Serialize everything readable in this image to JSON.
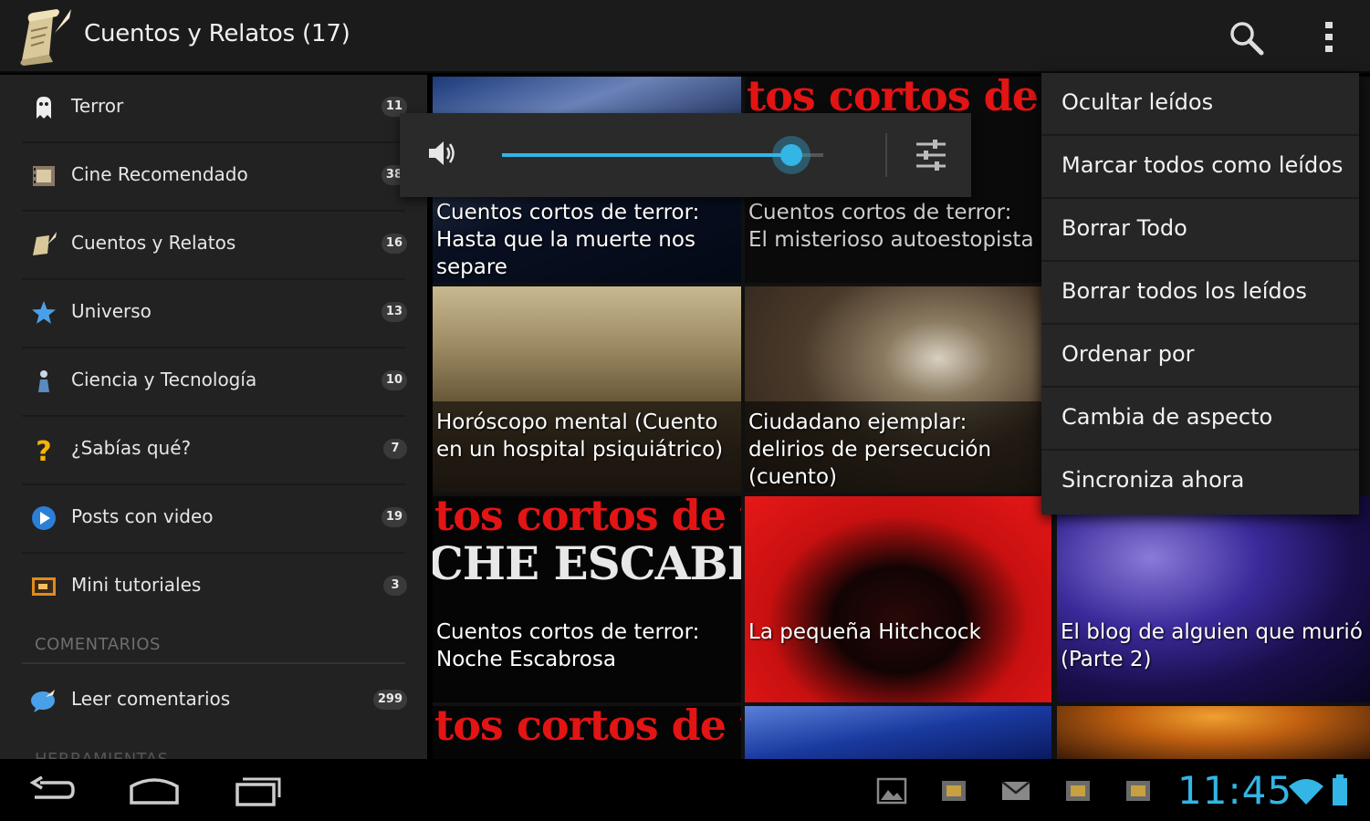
{
  "actionbar": {
    "title": "Cuentos y Relatos (17)",
    "icons": {
      "app": "scroll-quill-icon",
      "search": "search-icon",
      "overflow": "overflow-menu-icon"
    }
  },
  "drawer": {
    "items": [
      {
        "label": "Terror",
        "count": "11",
        "icon": "ghost-icon"
      },
      {
        "label": "Cine Recomendado",
        "count": "38",
        "icon": "film-icon"
      },
      {
        "label": "Cuentos y Relatos",
        "count": "16",
        "icon": "scroll-icon"
      },
      {
        "label": "Universo",
        "count": "13",
        "icon": "star-icon"
      },
      {
        "label": "Ciencia y Tecnología",
        "count": "10",
        "icon": "flask-icon"
      },
      {
        "label": "¿Sabías qué?",
        "count": "7",
        "icon": "question-icon"
      },
      {
        "label": "Posts con video",
        "count": "19",
        "icon": "play-icon"
      },
      {
        "label": "Mini tutoriales",
        "count": "3",
        "icon": "tutorial-icon"
      }
    ],
    "section_comments": "COMENTARIOS",
    "comments_item": {
      "label": "Leer comentarios",
      "count": "299",
      "icon": "comments-icon"
    },
    "section_tools": "HERRAMIENTAS"
  },
  "grid": {
    "cards": [
      {
        "caption": "Cuentos cortos de terror: Hasta que la muerte nos separe"
      },
      {
        "caption": "Cuentos cortos de terror: El misterioso autoestopista",
        "banner": "tos cortos de t"
      },
      {
        "caption": "Horóscopo mental (Cuento en un hospital psiquiátrico)"
      },
      {
        "caption": "Ciudadano ejemplar: delirios de persecución (cuento)"
      },
      {
        "caption": "Cuentos cortos de terror: Noche Escabrosa",
        "banner": "tos cortos de t",
        "banner2": "CHE ESCABRO"
      },
      {
        "caption": "La pequeña Hitchcock"
      },
      {
        "caption": "El blog de alguien que murió (Parte 2)"
      },
      {
        "caption": "",
        "banner": "tos cortos de t"
      }
    ]
  },
  "volume": {
    "level": 0.9,
    "icons": {
      "speaker": "speaker-icon",
      "settings": "sliders-icon"
    }
  },
  "menu": {
    "items": [
      "Ocultar leídos",
      "Marcar todos como leídos",
      "Borrar Todo",
      "Borrar todos los leídos",
      "Ordenar por",
      "Cambia de aspecto",
      "Sincroniza ahora"
    ]
  },
  "sysbar": {
    "time": "11:45",
    "icons": [
      "back-icon",
      "home-icon",
      "recents-icon",
      "gallery-icon",
      "app-notification-icon",
      "mail-icon",
      "app-notification-icon",
      "app-notification-icon",
      "wifi-icon",
      "battery-icon"
    ]
  },
  "colors": {
    "accent": "#33b5e5",
    "banner_red": "#e31414"
  }
}
